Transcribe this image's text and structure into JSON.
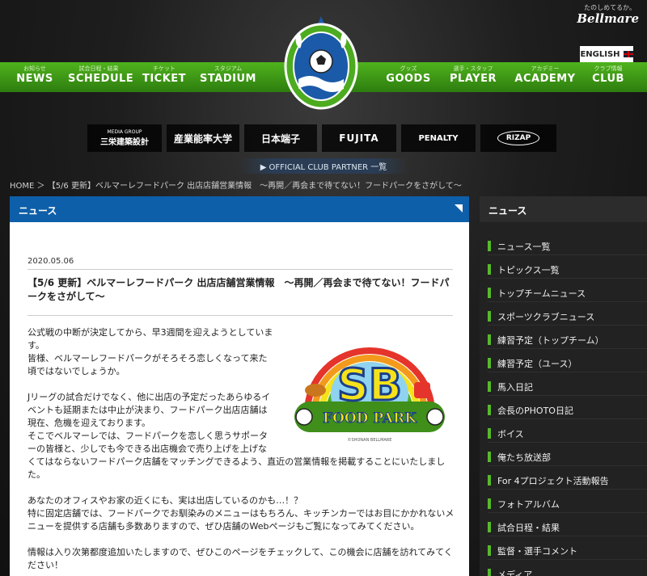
{
  "header": {
    "tagline": "たのしめてるか。",
    "brand": "Bellmare",
    "english_label": "ENGLISH"
  },
  "nav": [
    {
      "sub": "お知らせ",
      "label": "NEWS"
    },
    {
      "sub": "試合日程・結果",
      "label": "SCHEDULE"
    },
    {
      "sub": "チケット",
      "label": "TICKET"
    },
    {
      "sub": "スタジアム",
      "label": "STADIUM"
    },
    {
      "sub": "グッズ",
      "label": "GOODS"
    },
    {
      "sub": "選手・スタッフ",
      "label": "PLAYER"
    },
    {
      "sub": "アカデミー",
      "label": "ACADEMY"
    },
    {
      "sub": "クラブ情報",
      "label": "CLUB"
    }
  ],
  "emblem_text": "SHONAN BELLMARE",
  "sponsors": [
    {
      "small": "MEDIA GROUP",
      "name": "三栄建築設計"
    },
    {
      "small": "",
      "name": "産業能率大学"
    },
    {
      "small": "",
      "name": "日本端子"
    },
    {
      "small": "",
      "name": "FUJITA"
    },
    {
      "small": "",
      "name": "PENALTY"
    },
    {
      "small": "",
      "name": "RIZAP"
    }
  ],
  "partner_link": "▶ OFFICIAL CLUB PARTNER 一覧",
  "breadcrumb": "HOME ＞ 【5/6 更新】ベルマーレフードパーク 出店店舗営業情報　～再開／再会まで待てない！フードパークをさがして～",
  "main": {
    "heading": "ニュース",
    "date": "2020.05.06",
    "title": "【5/6 更新】ベルマーレフードパーク 出店店舗営業情報　～再開／再会まで待てない！フードパークをさがして～",
    "p1": [
      "公式戦の中断が決定してから、早3週間を迎えようとしていま",
      "す。",
      "皆様、ベルマーレフードパークがそろそろ恋しくなって来た",
      "頃ではないでしょうか。"
    ],
    "p2": [
      "Jリーグの試合だけでなく、他に出店の予定だったあらゆるイ",
      "ベントも延期または中止が決まり、フードパーク出店店舗は",
      "現在、危機を迎えております。",
      "そこでベルマーレでは、フードパークを恋しく思うサポータ",
      "ーの皆様と、少しでも今できる出店機会で売り上げを上げな",
      "くてはならないフードパーク店舗をマッチングできるよう、直近の営業情報を掲載することにいたしました。"
    ],
    "p3": [
      "あなたのオフィスやお家の近くにも、実は出店しているのかも…！？",
      "特に固定店舗では、フードパークでお馴染みのメニューはもちろん、キッチンカーではお目にかかれないメ",
      "ニューを提供する店舗も多数ありますので、ぜひ店舗のWebページもご覧になってみてください。"
    ],
    "p4": [
      "情報は入り次第都度追加いたしますので、ぜひこのページをチェックして、この機会に店舗を訪れてみてく",
      "ださい！"
    ],
    "logo": {
      "sb": "SB",
      "foodpark": "FOOD PARK",
      "copyright": "©SHONAN BELLMARE"
    }
  },
  "sidebar": {
    "heading": "ニュース",
    "items": [
      "ニュース一覧",
      "トピックス一覧",
      "トップチームニュース",
      "スポーツクラブニュース",
      "練習予定（トップチーム）",
      "練習予定（ユース）",
      "馬入日記",
      "会長のPHOTO日記",
      "ボイス",
      "俺たち放送部",
      "For 4プロジェクト活動報告",
      "フォトアルバム",
      "試合日程・結果",
      "監督・選手コメント",
      "メディア"
    ]
  },
  "colors": {
    "nav_green": "#3c9a18",
    "news_blue": "#0e5fa9",
    "side_green": "#58b92a"
  }
}
